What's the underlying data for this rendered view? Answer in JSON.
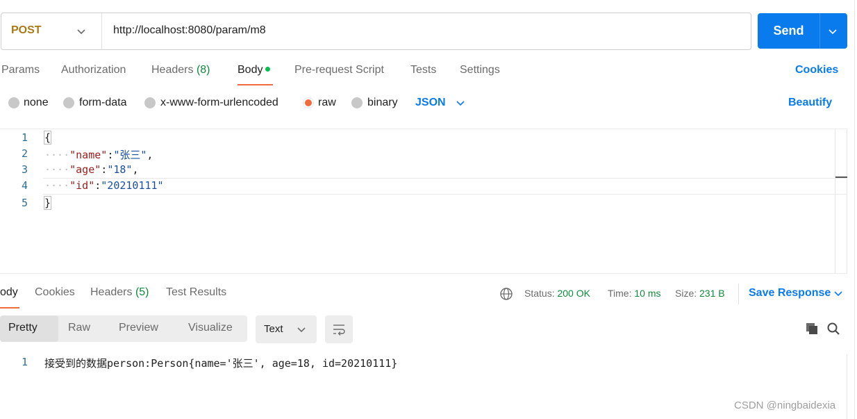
{
  "request": {
    "method": "POST",
    "url": "http://localhost:8080/param/m8",
    "send_label": "Send"
  },
  "request_tabs": [
    {
      "label": "Params"
    },
    {
      "label": "Authorization"
    },
    {
      "label": "Headers",
      "count": "(8)"
    },
    {
      "label": "Body"
    },
    {
      "label": "Pre-request Script"
    },
    {
      "label": "Tests"
    },
    {
      "label": "Settings"
    }
  ],
  "cookies_link": "Cookies",
  "body_types": [
    "none",
    "form-data",
    "x-www-form-urlencoded",
    "raw",
    "binary"
  ],
  "body_selected": "raw",
  "format": "JSON",
  "beautify": "Beautify",
  "editor": {
    "line_numbers": [
      "1",
      "2",
      "3",
      "4",
      "5"
    ],
    "open_brace": "{",
    "close_brace": "}",
    "indent": "····",
    "fields": [
      {
        "key": "\"name\"",
        "value": "\"张三\"",
        "comma": ","
      },
      {
        "key": "\"age\"",
        "value": "\"18\"",
        "comma": ","
      },
      {
        "key": "\"id\"",
        "value": "\"20210111\"",
        "comma": ""
      }
    ],
    "colon": ":"
  },
  "response": {
    "tabs": [
      {
        "label": "ody"
      },
      {
        "label": "Cookies"
      },
      {
        "label": "Headers",
        "count": "(5)"
      },
      {
        "label": "Test Results"
      }
    ],
    "status_label": "Status:",
    "status_value": "200 OK",
    "time_label": "Time:",
    "time_value": "10 ms",
    "size_label": "Size:",
    "size_value": "231 B",
    "save_response": "Save Response",
    "view_modes": [
      "Pretty",
      "Raw",
      "Preview",
      "Visualize"
    ],
    "text_format": "Text",
    "line_number": "1",
    "body_line": "接受到的数据person:Person{name='张三', age=18, id=20210111}"
  },
  "watermark": "CSDN @ningbaidexia",
  "colors": {
    "send": "#097bed",
    "method": "#a77a14",
    "accent": "#f26b3a",
    "link": "#097bed",
    "status_ok": "#0e8a3a"
  }
}
